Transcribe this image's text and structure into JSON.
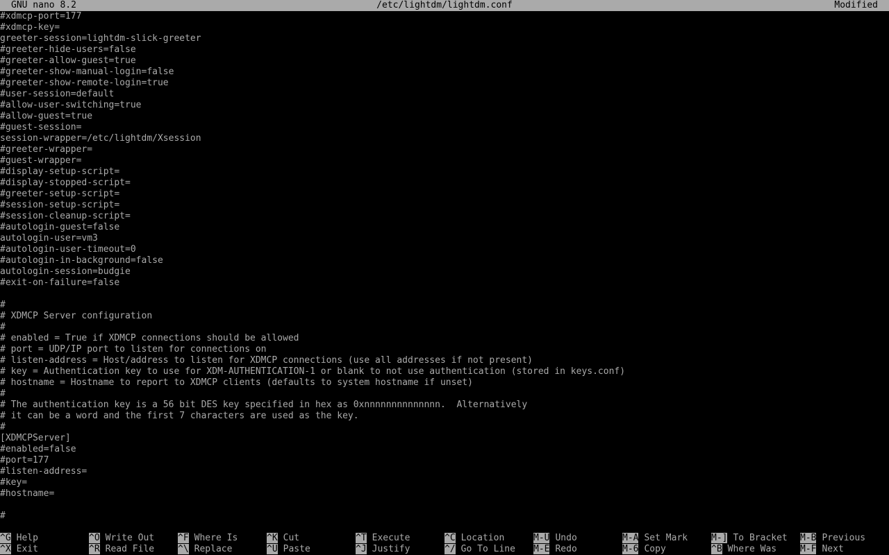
{
  "titlebar": {
    "app": "GNU nano 8.2",
    "file": "/etc/lightdm/lightdm.conf",
    "status": "Modified"
  },
  "editor": {
    "lines": [
      "#xdmcp-port=177",
      "#xdmcp-key=",
      "greeter-session=lightdm-slick-greeter",
      "#greeter-hide-users=false",
      "#greeter-allow-guest=true",
      "#greeter-show-manual-login=false",
      "#greeter-show-remote-login=true",
      "#user-session=default",
      "#allow-user-switching=true",
      "#allow-guest=true",
      "#guest-session=",
      "session-wrapper=/etc/lightdm/Xsession",
      "#greeter-wrapper=",
      "#guest-wrapper=",
      "#display-setup-script=",
      "#display-stopped-script=",
      "#greeter-setup-script=",
      "#session-setup-script=",
      "#session-cleanup-script=",
      "#autologin-guest=false",
      "autologin-user=vm3",
      "#autologin-user-timeout=0",
      "#autologin-in-background=false",
      "autologin-session=budgie",
      "#exit-on-failure=false",
      "",
      "#",
      "# XDMCP Server configuration",
      "#",
      "# enabled = True if XDMCP connections should be allowed",
      "# port = UDP/IP port to listen for connections on",
      "# listen-address = Host/address to listen for XDMCP connections (use all addresses if not present)",
      "# key = Authentication key to use for XDM-AUTHENTICATION-1 or blank to not use authentication (stored in keys.conf)",
      "# hostname = Hostname to report to XDMCP clients (defaults to system hostname if unset)",
      "#",
      "# The authentication key is a 56 bit DES key specified in hex as 0xnnnnnnnnnnnnnn.  Alternatively",
      "# it can be a word and the first 7 characters are used as the key.",
      "#",
      "[XDMCPServer]",
      "#enabled=false",
      "#port=177",
      "#listen-address=",
      "#key=",
      "#hostname=",
      "",
      "#"
    ]
  },
  "shortcuts": [
    {
      "key": "^G",
      "label": "Help"
    },
    {
      "key": "^X",
      "label": "Exit"
    },
    {
      "key": "^O",
      "label": "Write Out"
    },
    {
      "key": "^R",
      "label": "Read File"
    },
    {
      "key": "^F",
      "label": "Where Is"
    },
    {
      "key": "^\\",
      "label": "Replace"
    },
    {
      "key": "^K",
      "label": "Cut"
    },
    {
      "key": "^U",
      "label": "Paste"
    },
    {
      "key": "^T",
      "label": "Execute"
    },
    {
      "key": "^J",
      "label": "Justify"
    },
    {
      "key": "^C",
      "label": "Location"
    },
    {
      "key": "^/",
      "label": "Go To Line"
    },
    {
      "key": "M-U",
      "label": "Undo"
    },
    {
      "key": "M-E",
      "label": "Redo"
    },
    {
      "key": "M-A",
      "label": "Set Mark"
    },
    {
      "key": "M-6",
      "label": "Copy"
    },
    {
      "key": "M-]",
      "label": "To Bracket"
    },
    {
      "key": "^B",
      "label": "Where Was"
    },
    {
      "key": "M-B",
      "label": "Previous"
    },
    {
      "key": "M-F",
      "label": "Next"
    }
  ]
}
